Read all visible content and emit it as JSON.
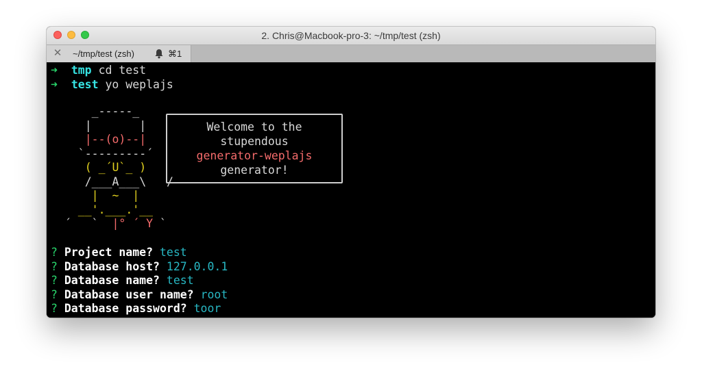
{
  "window": {
    "title": "2. Chris@Macbook-pro-3: ~/tmp/test (zsh)"
  },
  "tab": {
    "close_glyph": "✕",
    "label": "~/tmp/test (zsh)",
    "bell_icon": "bell-icon",
    "shortcut": "⌘1"
  },
  "terminal": {
    "commands": [
      {
        "prompt": "➜",
        "dir": "tmp",
        "cmd": "cd test"
      },
      {
        "prompt": "➜",
        "dir": "test",
        "cmd": "yo weplajs"
      }
    ],
    "yeoman_art": {
      "l1": "     _-----_",
      "l2": "    |       |",
      "l3": "    |--(o)--|",
      "l4": "   `---------´",
      "l5": "    ( _´U`_ )",
      "l6": "    /___A___\\   /",
      "l7": "     |  ~  |",
      "l8": "   __'.___.'__",
      "l9a": " ´   `  ",
      "l9b": "|° ´ Y",
      "l9c": " `"
    },
    "welcome": {
      "line1": "Welcome to the",
      "line2": "stupendous",
      "line3": "generator-weplajs",
      "line4": "generator!"
    },
    "prompts": [
      {
        "marker": "?",
        "question": "Project name?",
        "answer": "test"
      },
      {
        "marker": "?",
        "question": "Database host?",
        "answer": "127.0.0.1"
      },
      {
        "marker": "?",
        "question": "Database name?",
        "answer": "test"
      },
      {
        "marker": "?",
        "question": "Database user name?",
        "answer": "root"
      },
      {
        "marker": "?",
        "question": "Database password?",
        "answer": "toor"
      }
    ]
  },
  "colors": {
    "prompt_arrow": "#28d26a",
    "directory": "#36e3e3",
    "answer": "#28b8c4",
    "art_yellow": "#e3d21f",
    "generator_name": "#f46b6b"
  }
}
